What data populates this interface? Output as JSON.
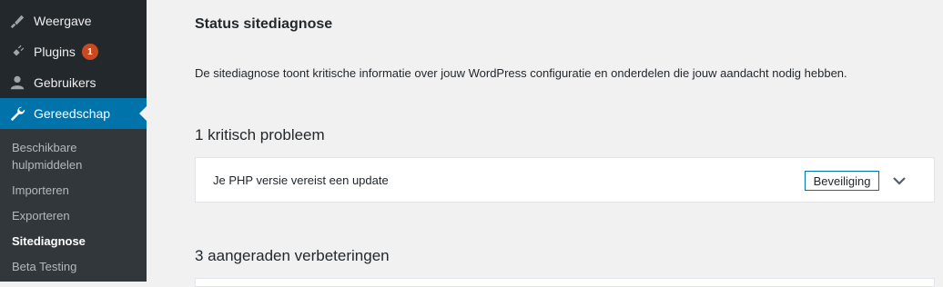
{
  "sidebar": {
    "menu": [
      {
        "label": "Weergave",
        "icon": "paintbrush-icon"
      },
      {
        "label": "Plugins",
        "icon": "plugin-icon",
        "badge": "1"
      },
      {
        "label": "Gebruikers",
        "icon": "user-icon"
      },
      {
        "label": "Gereedschap",
        "icon": "wrench-icon",
        "active": true
      }
    ],
    "submenu": [
      {
        "label": "Beschikbare hulpmiddelen"
      },
      {
        "label": "Importeren"
      },
      {
        "label": "Exporteren"
      },
      {
        "label": "Sitediagnose",
        "current": true
      },
      {
        "label": "Beta Testing"
      }
    ]
  },
  "main": {
    "title": "Status sitediagnose",
    "description": "De sitediagnose toont kritische informatie over jouw WordPress configuratie en onderdelen die jouw aandacht nodig hebben.",
    "critical": {
      "heading": "1 kritisch probleem",
      "issues": [
        {
          "label": "Je PHP versie vereist een update",
          "badge": "Beveiliging"
        }
      ]
    },
    "recommended": {
      "heading": "3 aangeraden verbeteringen"
    }
  },
  "colors": {
    "sidebar_bg": "#23282d",
    "submenu_bg": "#32373c",
    "accent": "#0073aa",
    "badge": "#ca4a1f",
    "page_bg": "#f1f1f1"
  }
}
